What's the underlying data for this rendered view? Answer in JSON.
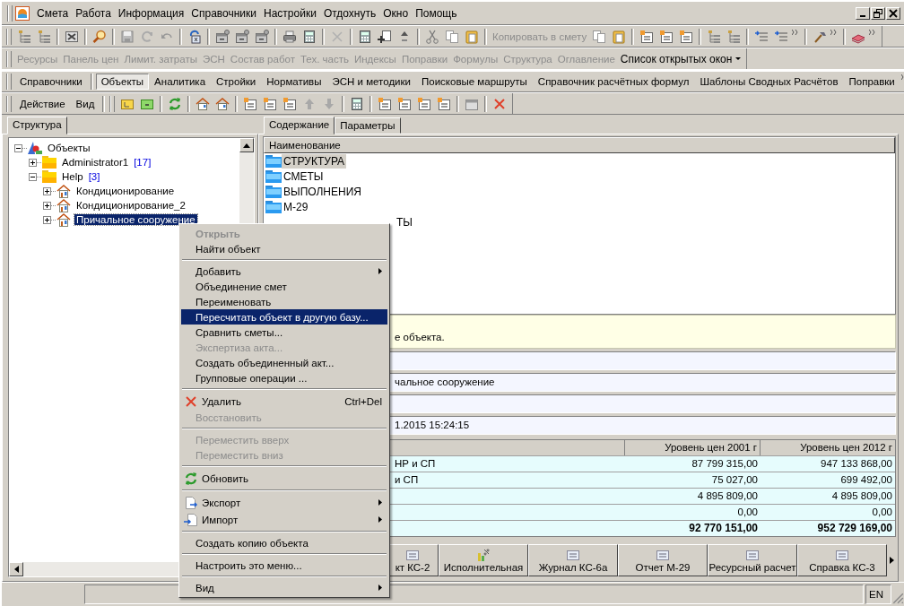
{
  "menu_bar": [
    "Смета",
    "Работа",
    "Информация",
    "Справочники",
    "Настройки",
    "Отдохнуть",
    "Окно",
    "Помощь"
  ],
  "toolbar": {
    "copy_button": {
      "label": "Копировать в смету",
      "disabled": true
    }
  },
  "panels_bar": [
    {
      "label": "Ресурсы",
      "disabled": true,
      "kind": "button"
    },
    {
      "label": "Панель цен",
      "disabled": true,
      "kind": "button"
    },
    {
      "label": "Лимит. затраты",
      "disabled": true,
      "kind": "button"
    },
    {
      "label": "ЭСН",
      "disabled": true,
      "kind": "button"
    },
    {
      "label": "Состав работ",
      "disabled": true,
      "kind": "button"
    },
    {
      "label": "Тех. часть",
      "disabled": true,
      "kind": "button"
    },
    {
      "label": "Индексы",
      "disabled": true,
      "kind": "button"
    },
    {
      "label": "Поправки",
      "disabled": true,
      "kind": "button"
    },
    {
      "label": "Формулы",
      "disabled": true,
      "kind": "button"
    },
    {
      "label": "Структура",
      "disabled": true,
      "kind": "button"
    },
    {
      "label": "Оглавление",
      "disabled": true,
      "kind": "button"
    },
    {
      "label": "Список открытых окон",
      "disabled": false,
      "kind": "dropdown"
    }
  ],
  "module_tabs": [
    {
      "label": "Справочники",
      "selected": false
    },
    {
      "label": "Объекты",
      "selected": true
    },
    {
      "label": "Аналитика",
      "selected": false
    },
    {
      "label": "Стройки",
      "selected": false
    },
    {
      "label": "Нормативы",
      "selected": false
    },
    {
      "label": "ЭСН и методики",
      "selected": false
    },
    {
      "label": "Поисковые маршруты",
      "selected": false
    },
    {
      "label": "Справочник расчётных формул",
      "selected": false
    },
    {
      "label": "Шаблоны Сводных Расчётов",
      "selected": false
    },
    {
      "label": "Поправки",
      "selected": false
    }
  ],
  "action_bar": [
    "Действие",
    "Вид"
  ],
  "left_panel": {
    "tabs": [
      {
        "label": "Структура",
        "selected": true
      }
    ],
    "tree": [
      {
        "label": "Объекты",
        "kind": "root",
        "expanded": true,
        "selected": false,
        "children": [
          {
            "label": "Administrator1",
            "count": "[17]",
            "kind": "folder",
            "expanded": false,
            "selected": false
          },
          {
            "label": "Help",
            "count": "[3]",
            "kind": "folder",
            "expanded": true,
            "selected": false,
            "children": [
              {
                "label": "Кондиционирование",
                "kind": "object",
                "expanded": false,
                "selected": false
              },
              {
                "label": "Кондиционирование_2",
                "kind": "object",
                "expanded": false,
                "selected": false
              },
              {
                "label": "Причальное сооружение",
                "kind": "object",
                "expanded": false,
                "selected": true
              }
            ]
          }
        ]
      }
    ]
  },
  "right_panel": {
    "tabs": [
      {
        "label": "Содержание",
        "selected": true
      },
      {
        "label": "Параметры",
        "selected": false
      }
    ],
    "list": {
      "column": "Наименование",
      "items": [
        {
          "label": "СТРУКТУРА",
          "selected": true
        },
        {
          "label": "СМЕТЫ",
          "selected": false
        },
        {
          "label": "ВЫПОЛНЕНИЯ",
          "selected": false
        },
        {
          "label": "М-29",
          "selected": false
        },
        {
          "label": "ТЫ",
          "selected": false
        }
      ]
    },
    "info": "е объекта.",
    "fields": {
      "field_2": "чальное сооружение",
      "field_4": "1.2015 15:24:15"
    },
    "table": {
      "columns": [
        "Уровень цен 2001 г",
        "Уровень цен 2012 г"
      ],
      "rows": [
        {
          "label": "НР и СП",
          "values": [
            "87 799 315,00",
            "947 133 868,00"
          ],
          "total": false
        },
        {
          "label": "и СП",
          "values": [
            "75 027,00",
            "699 492,00"
          ],
          "total": false
        },
        {
          "values": [
            "4 895 809,00",
            "4 895 809,00"
          ],
          "total": false
        },
        {
          "values": [
            "0,00",
            "0,00"
          ],
          "total": false
        },
        {
          "values": [
            "92 770 151,00",
            "952 729 169,00"
          ],
          "total": true
        }
      ]
    },
    "reports": [
      "кт КС-2",
      "Исполнительная",
      "Журнал КС-6а",
      "Отчет М-29",
      "Ресурсный расчет",
      "Справка КС-3"
    ]
  },
  "context_menu": [
    {
      "kind": "default",
      "label": "Открыть",
      "disabled": true,
      "selected": false,
      "submenu": false
    },
    {
      "kind": "item",
      "label": "Найти объект",
      "disabled": false,
      "selected": false,
      "submenu": false
    },
    {
      "kind": "separator"
    },
    {
      "kind": "item",
      "label": "Добавить",
      "disabled": false,
      "selected": false,
      "submenu": true
    },
    {
      "kind": "item",
      "label": "Объединение смет",
      "disabled": false,
      "selected": false,
      "submenu": false
    },
    {
      "kind": "item",
      "label": "Переименовать",
      "disabled": false,
      "selected": false,
      "submenu": false
    },
    {
      "kind": "item",
      "label": "Пересчитать объект в другую базу...",
      "disabled": false,
      "selected": true,
      "submenu": false
    },
    {
      "kind": "item",
      "label": "Сравнить сметы...",
      "disabled": false,
      "selected": false,
      "submenu": false
    },
    {
      "kind": "item",
      "label": "Экспертиза акта...",
      "disabled": true,
      "selected": false,
      "submenu": false
    },
    {
      "kind": "item",
      "label": "Создать объединенный акт...",
      "disabled": false,
      "selected": false,
      "submenu": false
    },
    {
      "kind": "item",
      "label": "Групповые операции ...",
      "disabled": false,
      "selected": false,
      "submenu": false
    },
    {
      "kind": "separator"
    },
    {
      "kind": "item",
      "label": "Удалить",
      "shortcut": "Ctrl+Del",
      "disabled": false,
      "selected": false,
      "submenu": false
    },
    {
      "kind": "item",
      "label": "Восстановить",
      "disabled": true,
      "selected": false,
      "submenu": false
    },
    {
      "kind": "separator"
    },
    {
      "kind": "item",
      "label": "Переместить вверх",
      "disabled": true,
      "selected": false,
      "submenu": false
    },
    {
      "kind": "item",
      "label": "Переместить вниз",
      "disabled": true,
      "selected": false,
      "submenu": false
    },
    {
      "kind": "separator"
    },
    {
      "kind": "item",
      "label": "Обновить",
      "disabled": false,
      "selected": false,
      "submenu": false
    },
    {
      "kind": "separator"
    },
    {
      "kind": "item",
      "label": "Экспорт",
      "disabled": false,
      "selected": false,
      "submenu": true
    },
    {
      "kind": "item",
      "label": "Импорт",
      "disabled": false,
      "selected": false,
      "submenu": true
    },
    {
      "kind": "separator"
    },
    {
      "kind": "item",
      "label": "Создать копию объекта",
      "disabled": false,
      "selected": false,
      "submenu": false
    },
    {
      "kind": "separator"
    },
    {
      "kind": "item",
      "label": "Настроить это меню...",
      "disabled": false,
      "selected": false,
      "submenu": false
    },
    {
      "kind": "separator"
    },
    {
      "kind": "item",
      "label": "Вид",
      "disabled": false,
      "selected": false,
      "submenu": true
    }
  ],
  "status_bar": {
    "language": "EN"
  }
}
